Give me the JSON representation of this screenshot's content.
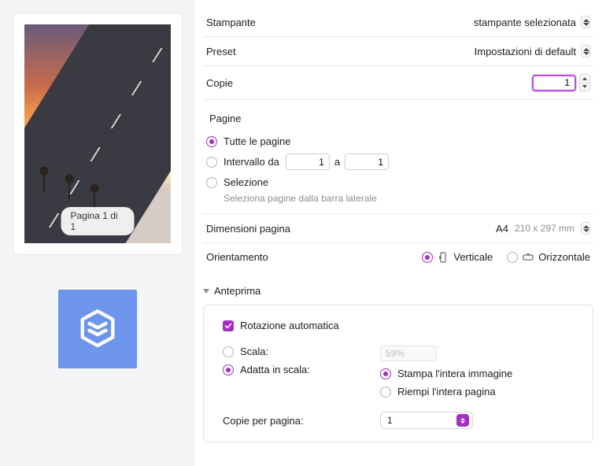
{
  "preview": {
    "page_badge": "Pagina 1 di 1"
  },
  "printer": {
    "label": "Stampante",
    "value": "stampante selezionata"
  },
  "preset": {
    "label": "Preset",
    "value": "Impostazioni di default"
  },
  "copies": {
    "label": "Copie",
    "value": "1"
  },
  "pages": {
    "label": "Pagine",
    "all": "Tutte le pagine",
    "range_label": "Intervallo da",
    "range_from": "1",
    "range_to_label": "a",
    "range_to": "1",
    "selection": "Selezione",
    "hint": "Seleziona pagine dalla barra laterale"
  },
  "page_size": {
    "label": "Dimensioni pagina",
    "value": "A4",
    "dims": "210 x 297 mm"
  },
  "orientation": {
    "label": "Orientamento",
    "portrait": "Verticale",
    "landscape": "Orizzontale"
  },
  "preview_section": {
    "title": "Anteprima",
    "auto_rotate": "Rotazione automatica",
    "scale": "Scala:",
    "scale_value": "59%",
    "fit": "Adatta in scala:",
    "print_entire": "Stampa l'intera immagine",
    "fill_page": "Riempi l'intera pagina",
    "copies_per_page": "Copie per pagina:",
    "copies_per_page_value": "1"
  }
}
